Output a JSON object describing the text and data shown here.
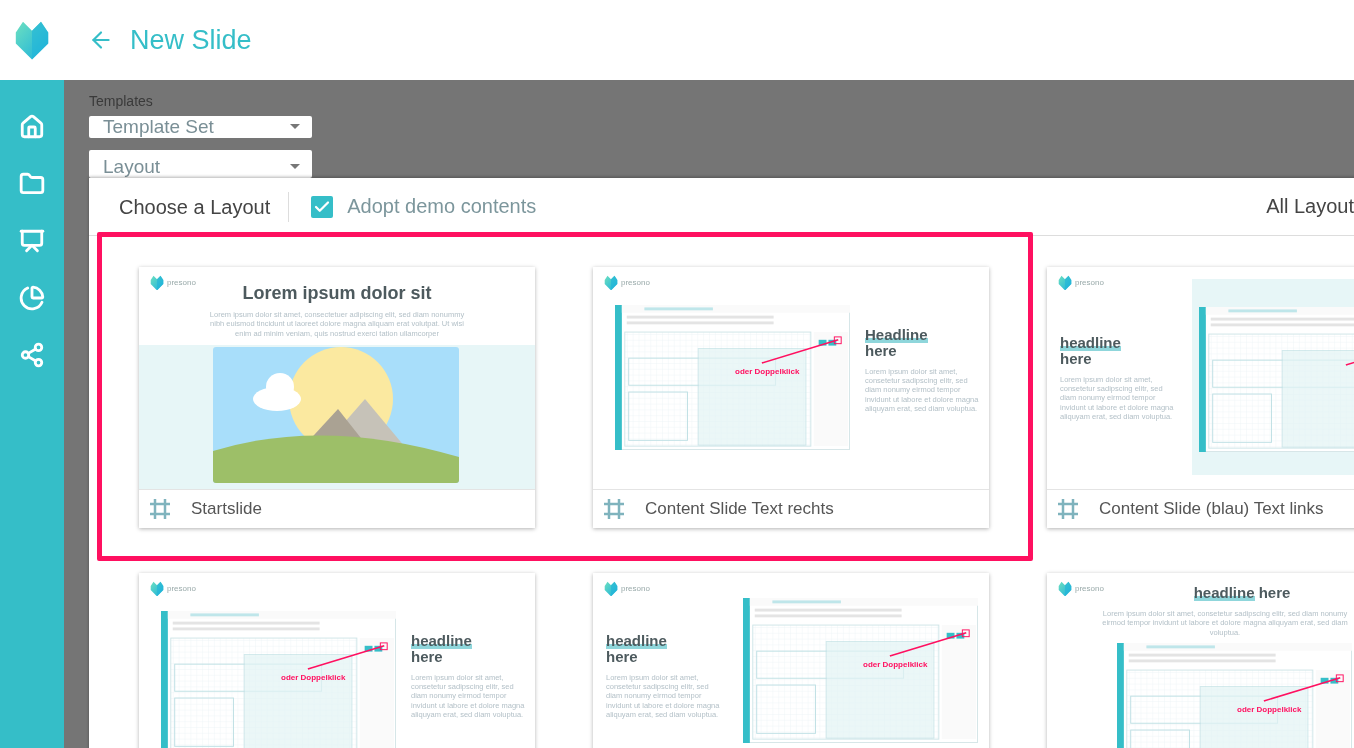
{
  "header": {
    "title": "New Slide"
  },
  "templates": {
    "label": "Templates",
    "selects": [
      {
        "placeholder": "Template Set"
      },
      {
        "placeholder": "Layout"
      }
    ]
  },
  "panel": {
    "title": "Choose a Layout",
    "adopt": {
      "label": "Adopt demo contents",
      "checked": true
    },
    "filter": "All Layout"
  },
  "cards": [
    {
      "kind": "title-picture",
      "name": "Startslide",
      "logo": "presono",
      "title": "Lorem ipsum dolor sit",
      "paragraph": "Lorem ipsum dolor sit amet, consectetuer adipiscing elit, sed diam nonummy nibh euismod tincidunt ut laoreet dolore magna aliquam erat volutpat. Ut wisi enim ad minim veniam, quis nostrud exerci tation ullamcorper"
    },
    {
      "kind": "text-right",
      "name": "Content Slide Text rechts",
      "logo": "presono",
      "headline": {
        "marked": "Headline",
        "rest": "here"
      },
      "paragraph": "Lorem ipsum dolor sit amet, consetetur sadipscing elitr, sed diam nonumy eirmod tempor invidunt ut labore et dolore magna aliquyam erat, sed diam voluptua.",
      "hint": "oder Doppelklick"
    },
    {
      "kind": "text-left",
      "name": "Content Slide (blau) Text links",
      "logo": "presono",
      "headline": {
        "marked": "headline",
        "rest": "here"
      },
      "paragraph": "Lorem ipsum dolor sit amet, consetetur sadipscing elitr, sed diam nonumy eirmod tempor invidunt ut labore et dolore magna aliquyam erat, sed diam voluptua.",
      "tinted": true
    },
    {
      "kind": "text-right",
      "logo": "presono",
      "headline": {
        "marked": "headline",
        "rest": "here"
      },
      "paragraph": "Lorem ipsum dolor sit amet, consetetur sadipscing elitr, sed diam nonumy eirmod tempor invidunt ut labore et dolore magna aliquyam erat, sed diam voluptua.",
      "hint": "oder Doppelklick"
    },
    {
      "kind": "text-left",
      "logo": "presono",
      "headline": {
        "marked": "headline",
        "rest": "here"
      },
      "paragraph": "Lorem ipsum dolor sit amet, consetetur sadipscing elitr, sed diam nonumy eirmod tempor invidunt ut labore et dolore magna aliquyam erat, sed diam voluptua.",
      "hint": "oder Doppelklick"
    },
    {
      "kind": "title-top",
      "logo": "presono",
      "headline": {
        "marked": "headline",
        "rest": "here"
      },
      "paragraph": "Lorem ipsum dolor sit amet, consetetur sadipscing elitr, sed diam nonumy eirmod tempor invidunt ut labore et dolore magna aliquyam erat, sed diam voluptua.",
      "hint": "oder Doppelklick"
    }
  ]
}
